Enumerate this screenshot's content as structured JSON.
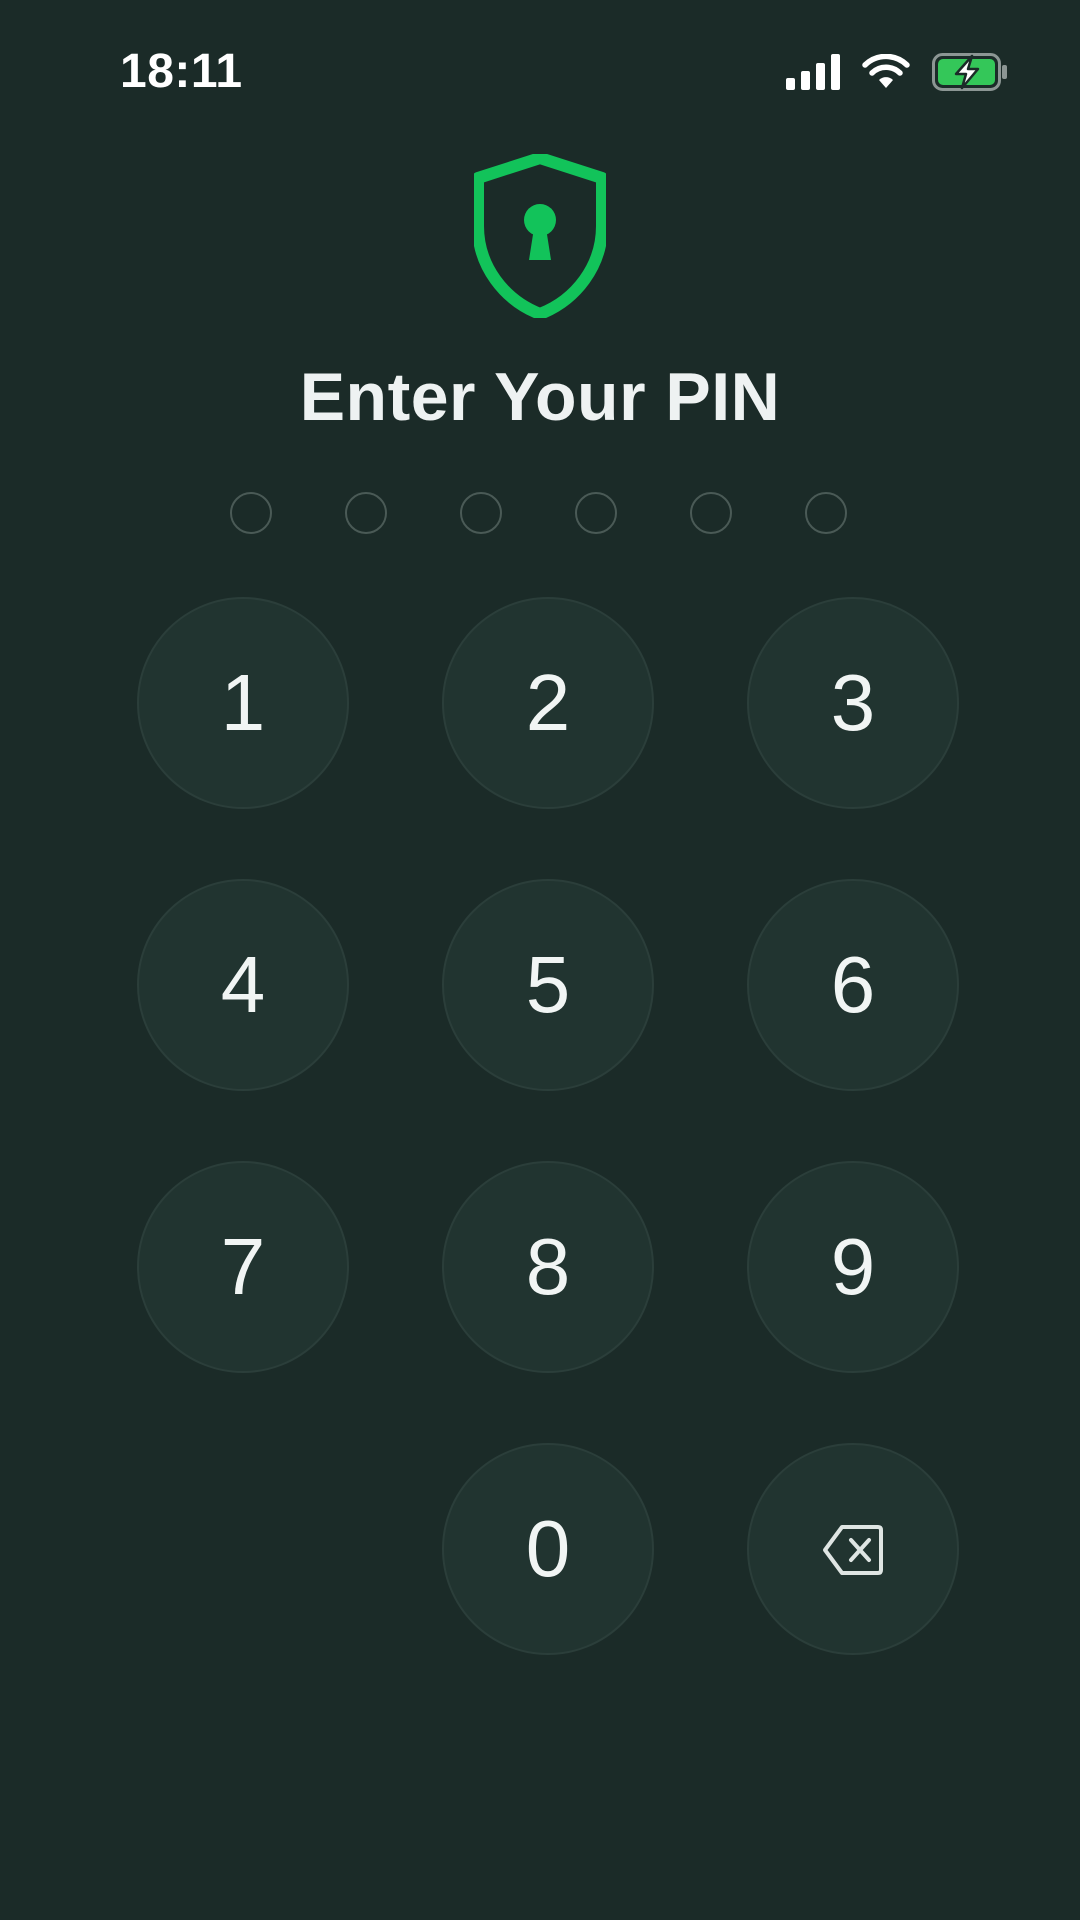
{
  "status_bar": {
    "time": "18:11",
    "icons": [
      "cellular-signal-icon",
      "wifi-icon",
      "battery-charging-icon"
    ],
    "battery_color": "#34c759"
  },
  "header": {
    "logo_icon": "shield-keyhole-icon",
    "logo_color": "#12c35a",
    "title": "Enter Your PIN"
  },
  "pin": {
    "length": 6,
    "entered": 0
  },
  "keypad": {
    "keys": [
      "1",
      "2",
      "3",
      "4",
      "5",
      "6",
      "7",
      "8",
      "9",
      "0"
    ],
    "delete_icon": "backspace-icon"
  },
  "colors": {
    "background": "#1b2b28",
    "key_fill": "#213430",
    "accent": "#12c35a"
  }
}
